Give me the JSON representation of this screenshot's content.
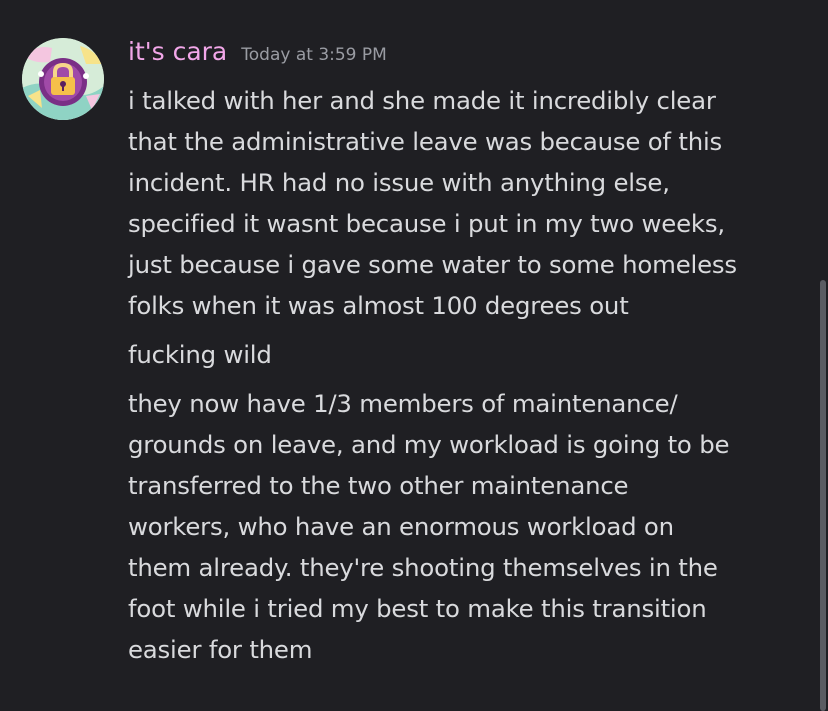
{
  "message": {
    "author": "it's cara",
    "timestamp": "Today at 3:59 PM",
    "avatar_icon": "lock-avatar-icon",
    "username_color": "#f2a7e9",
    "lines": [
      [
        "i talked with her and she made it incredibly clear",
        "that the administrative leave was because of this",
        "incident. HR had no issue with anything else,",
        "specified it wasnt because i put in my two weeks,",
        "just because i gave some water to some homeless",
        "folks when it was almost 100 degrees out"
      ],
      [
        "fucking wild"
      ],
      [
        "they now have 1/3 members of maintenance/",
        "grounds on leave, and my workload is going to be",
        "transferred to the two other maintenance",
        "workers, who have an enormous workload on",
        "them already. they're shooting themselves in the",
        "foot while i tried my best to make this transition",
        "easier for them"
      ]
    ]
  }
}
